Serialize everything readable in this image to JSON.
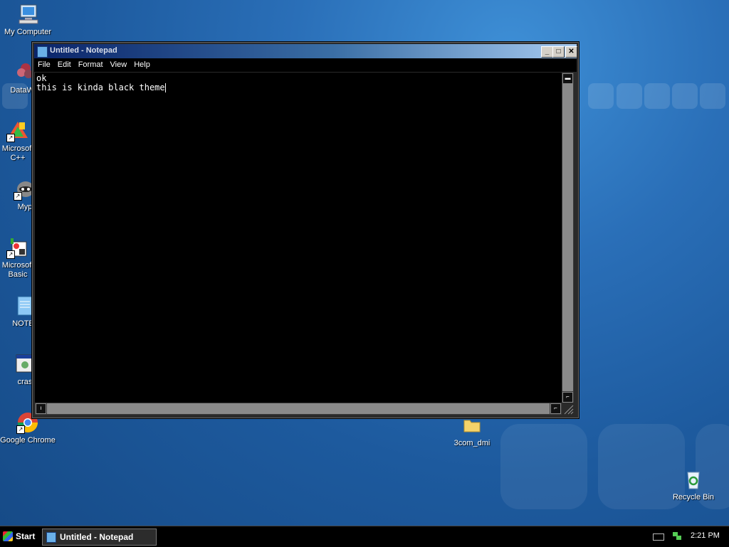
{
  "desktop": {
    "icons": [
      {
        "label": "My Computer",
        "glyph": "computer-icon"
      },
      {
        "label": "DataWa",
        "glyph": "datawarehouse-icon"
      },
      {
        "label": "Microsoft C++",
        "glyph": "visual-cpp-icon"
      },
      {
        "label": "Myp",
        "glyph": "raccoon-icon"
      },
      {
        "label": "Microsoft Basic",
        "glyph": "visual-basic-icon"
      },
      {
        "label": "NOTEI",
        "glyph": "notepad-icon"
      },
      {
        "label": "cras",
        "glyph": "program-window-icon"
      },
      {
        "label": "Google Chrome",
        "glyph": "chrome-icon"
      },
      {
        "label": "3com_dmi",
        "glyph": "folder-icon"
      },
      {
        "label": "Recycle Bin",
        "glyph": "recycle-bin-icon"
      }
    ]
  },
  "window": {
    "title": "Untitled - Notepad",
    "minimize_glyph": "_",
    "maximize_glyph": "□",
    "close_glyph": "✕",
    "menu": [
      "File",
      "Edit",
      "Format",
      "View",
      "Help"
    ],
    "content_lines": [
      "ok",
      "this is kinda black theme"
    ]
  },
  "taskbar": {
    "start_label": "Start",
    "task_label": "Untitled - Notepad",
    "clock": "2:21 PM"
  },
  "colors": {
    "desktop_blue": "#1d5a9e",
    "editor_bg": "#000000",
    "editor_fg": "#ffffff",
    "title_gradient_start": "#0a246a"
  }
}
